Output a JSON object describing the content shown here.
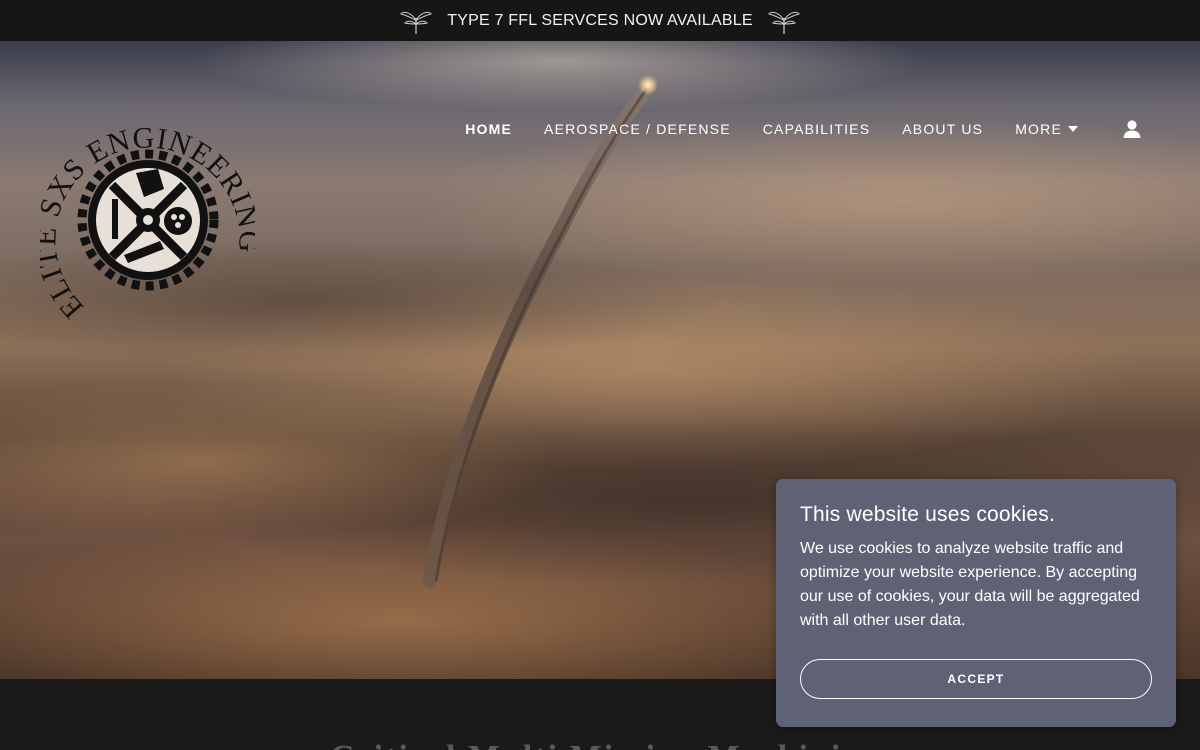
{
  "announcement": {
    "text": "TYPE 7 FFL SERVCES NOW AVAILABLE",
    "left_icon": "sprout-icon",
    "right_icon": "sprout-icon"
  },
  "logo": {
    "text": "ELITE SXS ENGINEERING",
    "emblem": "gear-emblem-icon"
  },
  "nav": {
    "items": [
      {
        "label": "HOME",
        "active": true
      },
      {
        "label": "AEROSPACE / DEFENSE",
        "active": false
      },
      {
        "label": "CAPABILITIES",
        "active": false
      },
      {
        "label": "ABOUT US",
        "active": false
      },
      {
        "label": "MORE",
        "active": false,
        "icon": "caret-down-icon"
      }
    ],
    "account_icon": "user-icon"
  },
  "hero": {
    "image": "rocket-launch-above-clouds"
  },
  "section": {
    "heading": "Critical Multi Mission Machining"
  },
  "cookie_banner": {
    "title": "This website uses cookies.",
    "body": "We use cookies to analyze website traffic and optimize your website experience. By accepting our use of cookies, your data will be aggregated with all other user data.",
    "accept_label": "ACCEPT",
    "background": "#5f6275"
  }
}
